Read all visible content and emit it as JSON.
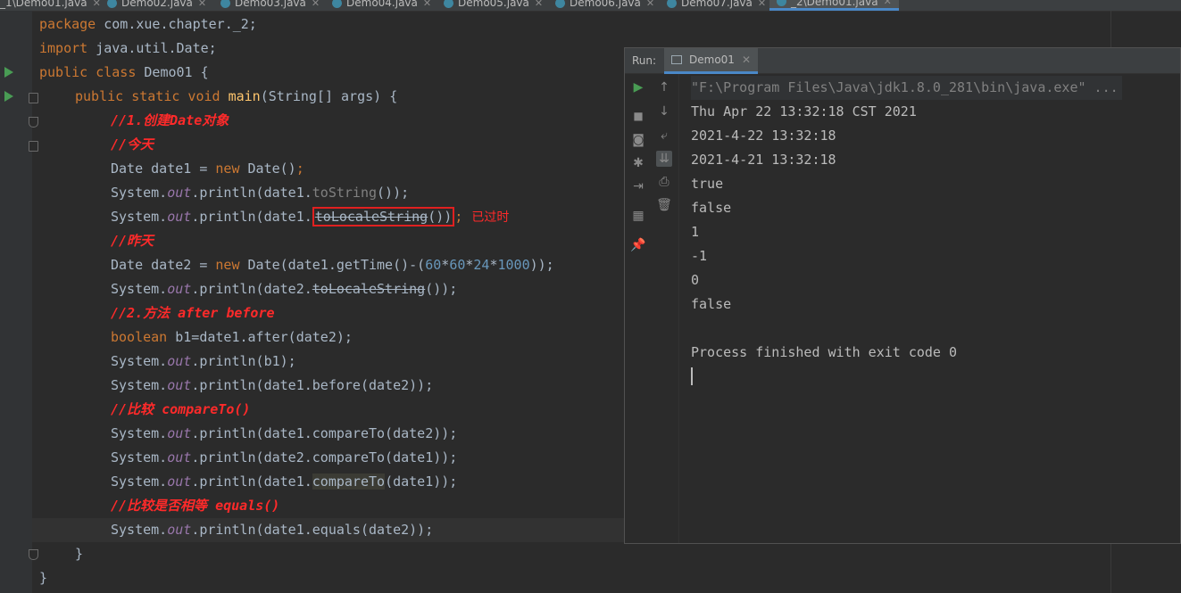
{
  "tabs": [
    {
      "label": "_1\\Demo01.java",
      "active": false
    },
    {
      "label": "Demo02.java",
      "active": false
    },
    {
      "label": "Demo03.java",
      "active": false
    },
    {
      "label": "Demo04.java",
      "active": false
    },
    {
      "label": "Demo05.java",
      "active": false
    },
    {
      "label": "Demo06.java",
      "active": false
    },
    {
      "label": "Demo07.java",
      "active": false
    },
    {
      "label": "_2\\Demo01.java",
      "active": true
    }
  ],
  "code": {
    "l1": {
      "kw": "package",
      "rest": " com.xue.chapter._2;"
    },
    "l2": {
      "kw": "import",
      "rest": " java.util.Date;"
    },
    "l3": {
      "kw": "public class",
      "rest": " Demo01 {"
    },
    "l4": {
      "kw": "public static void",
      "fn": "main",
      "rest": "(String[] args) {"
    },
    "l5": "//1.创建Date对象",
    "l6": "//今天",
    "l7": {
      "a": "Date date1 = ",
      "kw": "new",
      "b": " Date()",
      "c": ";"
    },
    "l8": {
      "a": "System.",
      "out": "out",
      "b": ".println(date1.",
      "mute": "toString",
      "c": "());"
    },
    "l9": {
      "a": "System.",
      "out": "out",
      "b": ".println(date1.",
      "dep": "toLocaleString",
      "c": "())",
      "d": ";",
      "note": "已过时"
    },
    "l10": "//昨天",
    "l11": {
      "a": "Date date2 = ",
      "kw": "new",
      "b": " Date(date1.getTime()-(",
      "n1": "60",
      "s1": "*",
      "n2": "60",
      "s2": "*",
      "n3": "24",
      "s3": "*",
      "n4": "1000",
      "c": "));"
    },
    "l12": {
      "a": "System.",
      "out": "out",
      "b": ".println(date2.",
      "dep": "toLocaleString",
      "c": "());"
    },
    "l13": "//2.方法 after before",
    "l14": {
      "kw": "boolean",
      "b": " b1=date1.after(date2);"
    },
    "l15": {
      "a": "System.",
      "out": "out",
      "b": ".println(b1);"
    },
    "l16": {
      "a": "System.",
      "out": "out",
      "b": ".println(date1.before(date2));"
    },
    "l17": "//比较 compareTo()",
    "l18": {
      "a": "System.",
      "out": "out",
      "b": ".println(date1.compareTo(date2));"
    },
    "l19": {
      "a": "System.",
      "out": "out",
      "b": ".println(date2.compareTo(date1));"
    },
    "l20": {
      "a": "System.",
      "out": "out",
      "b": ".println(date1.",
      "hl": "compareTo",
      "c": "(date1));"
    },
    "l21": "//比较是否相等 equals()",
    "l22": {
      "a": "System.",
      "out": "out",
      "b": ".println(date1.equals(date2));"
    },
    "l23": "}",
    "l24": "}"
  },
  "run": {
    "label": "Run:",
    "tab": "Demo01",
    "output": [
      "\"F:\\Program Files\\Java\\jdk1.8.0_281\\bin\\java.exe\" ...",
      "Thu Apr 22 13:32:18 CST 2021",
      "2021-4-22 13:32:18",
      "2021-4-21 13:32:18",
      "true",
      "false",
      "1",
      "-1",
      "0",
      "false",
      "",
      "Process finished with exit code 0"
    ]
  },
  "colors": {
    "keyword": "#cc7832",
    "method": "#ffc66d",
    "static_field": "#9876aa",
    "number": "#6897bb",
    "annotation_red": "#ff2a2a"
  }
}
